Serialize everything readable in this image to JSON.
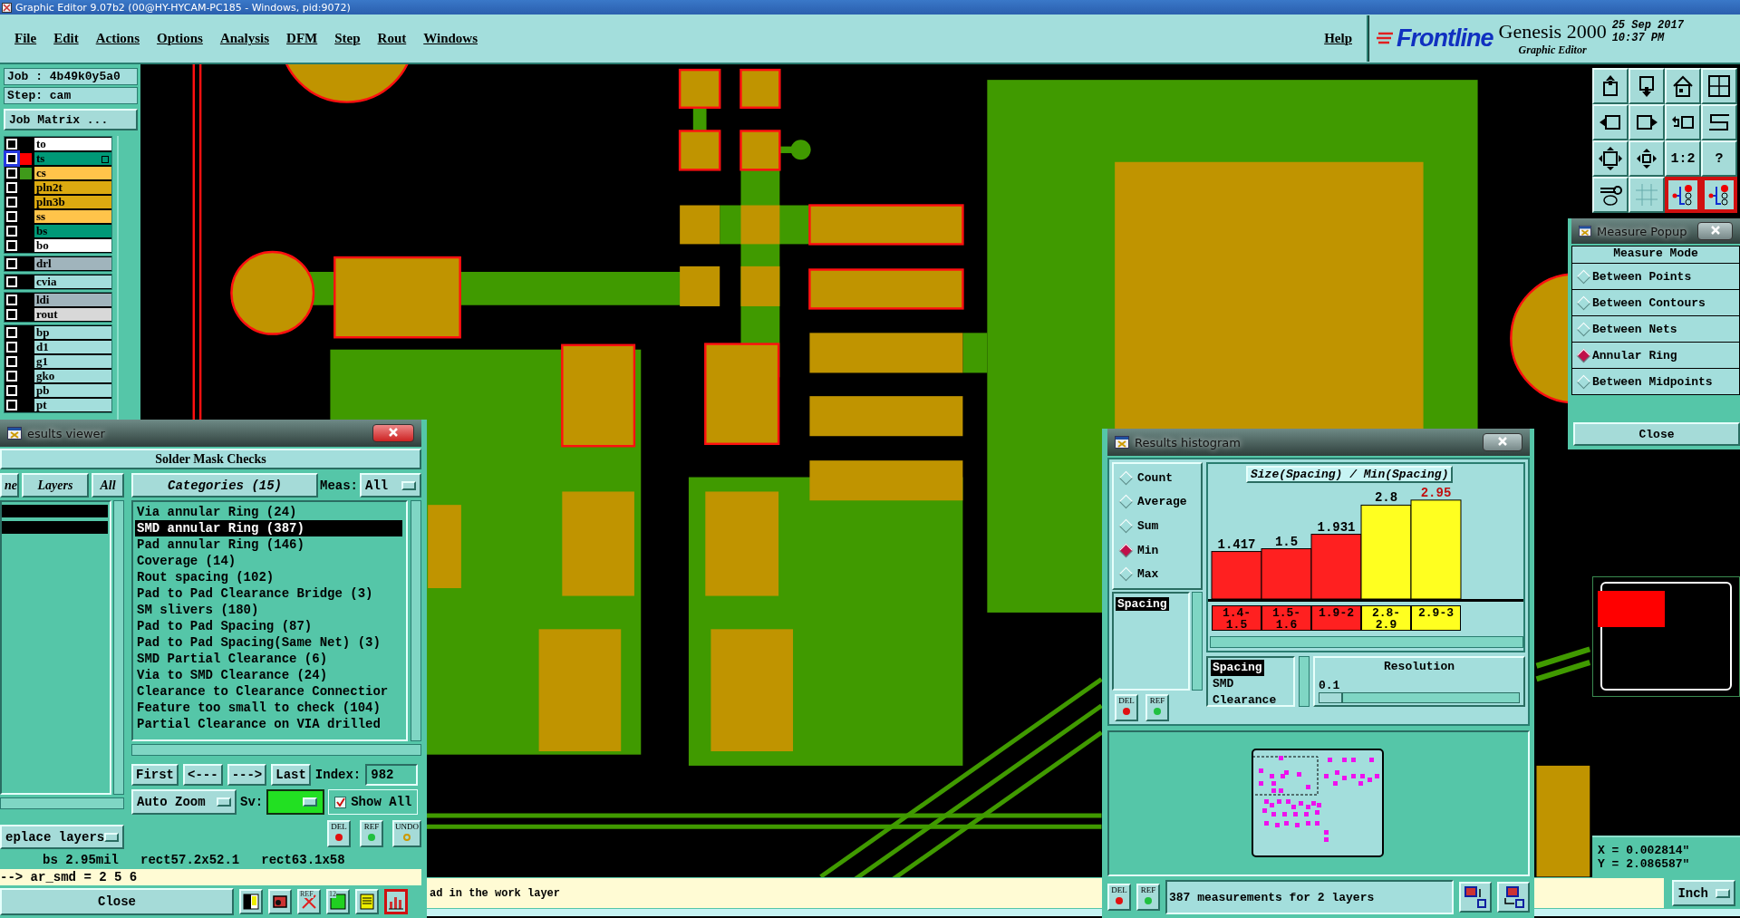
{
  "window": {
    "title": "Graphic Editor 9.07b2 (00@HY-HYCAM-PC185 - Windows, pid:9072)"
  },
  "menu": [
    "File",
    "Edit",
    "Actions",
    "Options",
    "Analysis",
    "DFM",
    "Step",
    "Rout",
    "Windows"
  ],
  "help": "Help",
  "brand": {
    "logo": "Frontline",
    "product": "Genesis 2000",
    "subtitle": "Graphic Editor",
    "date": "25 Sep 2017",
    "time": "10:37 PM"
  },
  "job": {
    "job": "Job : 4b49k0y5a0",
    "step": "Step: cam",
    "matrix_button": "Job Matrix ..."
  },
  "layer_groups": [
    {
      "layers": [
        {
          "name": "to",
          "kind": "silk",
          "selected": false
        },
        {
          "name": "ts",
          "kind": "mask",
          "color": "#ff0000",
          "selected": true
        },
        {
          "name": "cs",
          "kind": "signal",
          "color": "#3f9a1a",
          "selected": false
        },
        {
          "name": "pln2t",
          "kind": "plane",
          "selected": false
        },
        {
          "name": "pln3b",
          "kind": "plane",
          "selected": false
        },
        {
          "name": "ss",
          "kind": "signal",
          "selected": false
        },
        {
          "name": "bs",
          "kind": "mask",
          "selected": false
        },
        {
          "name": "bo",
          "kind": "silk",
          "selected": false
        }
      ]
    },
    {
      "layers": [
        {
          "name": "drl",
          "kind": "drill",
          "selected": false
        }
      ]
    },
    {
      "layers": [
        {
          "name": "cvia",
          "kind": "misc",
          "selected": false
        }
      ]
    },
    {
      "layers": [
        {
          "name": "ldi",
          "kind": "drill",
          "selected": false
        },
        {
          "name": "rout",
          "kind": "rout",
          "selected": false
        }
      ]
    },
    {
      "layers": [
        {
          "name": "bp",
          "kind": "misc",
          "selected": false
        },
        {
          "name": "d1",
          "kind": "misc",
          "selected": false
        },
        {
          "name": "g1",
          "kind": "misc",
          "selected": false
        },
        {
          "name": "gko",
          "kind": "misc",
          "selected": false
        },
        {
          "name": "pb",
          "kind": "misc",
          "selected": false
        },
        {
          "name": "pt",
          "kind": "misc",
          "selected": false
        }
      ]
    }
  ],
  "toolbar": [
    {
      "kind": "up",
      "on": false
    },
    {
      "kind": "down",
      "on": false
    },
    {
      "kind": "home",
      "on": false
    },
    {
      "kind": "panes",
      "on": false
    },
    {
      "kind": "left",
      "on": false
    },
    {
      "kind": "right",
      "on": false
    },
    {
      "kind": "undo",
      "on": false
    },
    {
      "kind": "snake",
      "on": false
    },
    {
      "kind": "fit",
      "on": false
    },
    {
      "kind": "center",
      "on": false
    },
    {
      "kind": "text",
      "label": "1:2",
      "on": false
    },
    {
      "kind": "text",
      "label": "?",
      "on": false
    },
    {
      "kind": "tools",
      "on": false
    },
    {
      "kind": "grid",
      "on": false
    },
    {
      "kind": "net",
      "on": true
    },
    {
      "kind": "net",
      "on": true
    }
  ],
  "measure_popup": {
    "title": "Measure Popup",
    "header": "Measure Mode",
    "modes": [
      {
        "label": "Between Points",
        "selected": false
      },
      {
        "label": "Between Contours",
        "selected": false
      },
      {
        "label": "Between Nets",
        "selected": false
      },
      {
        "label": "Annular Ring",
        "selected": true
      },
      {
        "label": "Between Midpoints",
        "selected": false
      }
    ],
    "close": "Close"
  },
  "coords": {
    "x": "X = 0.002814\"",
    "y": "Y = 2.086587\""
  },
  "message": "ad in the work layer",
  "units": "Inch",
  "results_viewer": {
    "title": "esults viewer",
    "header": "Solder Mask Checks",
    "left_tabs": [
      "ne",
      "Layers",
      "All"
    ],
    "categories_button": "Categories (15)",
    "meas_label": "Meas:",
    "meas_value": "All",
    "categories": [
      {
        "label": "Via annular Ring (24)",
        "selected": false
      },
      {
        "label": "SMD annular Ring (387)",
        "selected": true
      },
      {
        "label": "Pad annular Ring (146)",
        "selected": false
      },
      {
        "label": "Coverage (14)",
        "selected": false
      },
      {
        "label": "Rout spacing (102)",
        "selected": false
      },
      {
        "label": "Pad to Pad Clearance Bridge (3)",
        "selected": false
      },
      {
        "label": "SM slivers (180)",
        "selected": false
      },
      {
        "label": "Pad to Pad Spacing (87)",
        "selected": false
      },
      {
        "label": "Pad to Pad Spacing(Same Net) (3)",
        "selected": false
      },
      {
        "label": "SMD Partial Clearance (6)",
        "selected": false
      },
      {
        "label": "Via to SMD Clearance (24)",
        "selected": false
      },
      {
        "label": "Clearance to Clearance Connectior",
        "selected": false
      },
      {
        "label": "Feature too small to check (104)",
        "selected": false
      },
      {
        "label": "Partial Clearance on VIA drilled",
        "selected": false
      }
    ],
    "nav": [
      "First",
      "<---",
      "--->",
      "Last"
    ],
    "index_label": "Index:",
    "index_value": "982",
    "zoom_mode": "Auto Zoom",
    "sv": {
      "label": "Sv:",
      "color": "#22e022"
    },
    "show_all": {
      "label": "Show All",
      "checked": true
    },
    "replace": "eplace layers",
    "tools": [
      "DEL",
      "REF",
      "UNDO"
    ],
    "status": [
      "bs 2.95mil",
      "rect57.2x52.1",
      "rect63.1x58"
    ],
    "command": "--> ar_smd = 2 5 6",
    "close": "Close",
    "bottom_tools": [
      {
        "kind": "person",
        "on": false
      },
      {
        "kind": "record",
        "on": false
      },
      {
        "kind": "noref",
        "label": "REF",
        "on": false
      },
      {
        "kind": "page",
        "label": "12",
        "on": false
      },
      {
        "kind": "notes",
        "on": false
      },
      {
        "kind": "histogram",
        "on": true
      }
    ]
  },
  "histogram": {
    "title": "Results histogram",
    "functions": [
      {
        "label": "Count",
        "selected": false
      },
      {
        "label": "Average",
        "selected": false
      },
      {
        "label": "Sum",
        "selected": false
      },
      {
        "label": "Min",
        "selected": true
      },
      {
        "label": "Max",
        "selected": false
      }
    ],
    "fields": [
      {
        "label": "Spacing",
        "selected": true
      }
    ],
    "tools": [
      "DEL",
      "REF"
    ],
    "chart_data": {
      "type": "bar",
      "title": "Size(Spacing) / Min(Spacing)",
      "categories": [
        "1.4-1.5",
        "1.5-1.6",
        "1.9-2",
        "2.8-2.9",
        "2.9-3"
      ],
      "series": [
        {
          "color": "#ff2020",
          "values": [
            1.417,
            1.5,
            1.931,
            null,
            null
          ]
        },
        {
          "color": "#ffff20",
          "values": [
            null,
            null,
            null,
            2.8,
            2.95
          ]
        }
      ],
      "stacked": true,
      "data_labels": true
    },
    "types": [
      {
        "label": "Spacing",
        "selected": true
      },
      {
        "label": "SMD",
        "selected": false
      },
      {
        "label": "Clearance",
        "selected": false
      }
    ],
    "resolution": {
      "label": "Resolution",
      "value": "0.1",
      "level": 0.12
    },
    "summary": "387 measurements for 2 layers",
    "bottom_tools": [
      "DEL",
      "REF"
    ]
  }
}
